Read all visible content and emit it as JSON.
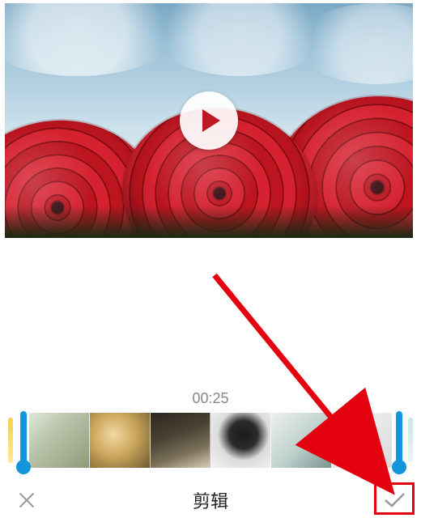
{
  "preview": {
    "play_label": "play"
  },
  "timeline": {
    "timecode": "00:25",
    "handle_left_color": "#1296db",
    "handle_right_color": "#1296db"
  },
  "bottom": {
    "cancel_label": "取消",
    "title": "剪辑",
    "confirm_label": "确认"
  },
  "annotation": {
    "target": "confirm-button"
  }
}
